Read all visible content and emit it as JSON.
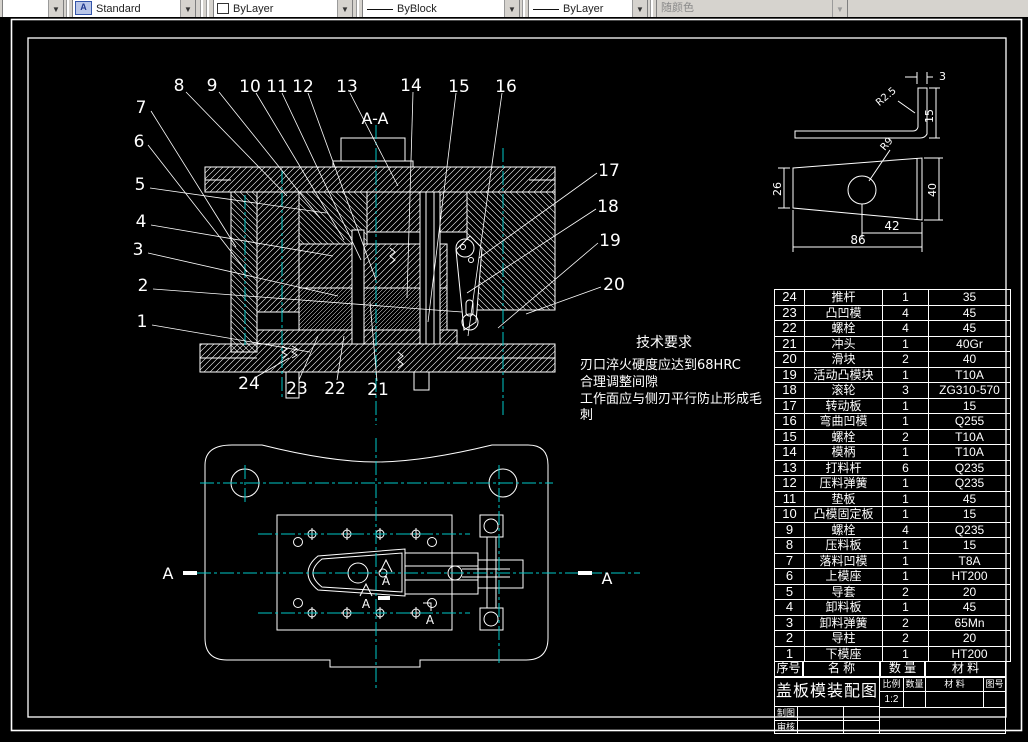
{
  "toolbar": {
    "layer_control": "",
    "text_style": "Standard",
    "color_control": "ByLayer",
    "linetype_control": "ByBlock",
    "lineweight_control": "ByLayer",
    "plot_style_control": "随颜色"
  },
  "tech_requirements": {
    "title": "技术要求",
    "lines": [
      "刃口淬火硬度应达到68HRC",
      "合理调整间隙",
      "工作面应与侧刃平行防止形成毛",
      "刺"
    ]
  },
  "drawing": {
    "section_label": "A-A",
    "section_marker": "A",
    "callouts": [
      "1",
      "2",
      "3",
      "4",
      "5",
      "6",
      "7",
      "8",
      "9",
      "10",
      "11",
      "12",
      "13",
      "14",
      "15",
      "16",
      "17",
      "18",
      "19",
      "20",
      "21",
      "22",
      "23",
      "24"
    ],
    "detail_dims": {
      "thickness": "3",
      "flange_height": "15",
      "bend_radius": "R2.5",
      "hole_radius": "R9",
      "left_width": "26",
      "right_width": "40",
      "hole_offset": "42",
      "length": "86"
    }
  },
  "parts_table": {
    "headers": [
      "序号",
      "名  称",
      "数 量",
      "材  料"
    ],
    "rows": [
      [
        "24",
        "推杆",
        "1",
        "35"
      ],
      [
        "23",
        "凸凹模",
        "4",
        "45"
      ],
      [
        "22",
        "螺栓",
        "4",
        "45"
      ],
      [
        "21",
        "冲头",
        "1",
        "40Gr"
      ],
      [
        "20",
        "滑块",
        "2",
        "40"
      ],
      [
        "19",
        "活动凸模块",
        "1",
        "T10A"
      ],
      [
        "18",
        "滚轮",
        "3",
        "ZG310-570"
      ],
      [
        "17",
        "转动板",
        "1",
        "15"
      ],
      [
        "16",
        "弯曲凹模",
        "1",
        "Q255"
      ],
      [
        "15",
        "螺栓",
        "2",
        "T10A"
      ],
      [
        "14",
        "模柄",
        "1",
        "T10A"
      ],
      [
        "13",
        "打料杆",
        "6",
        "Q235"
      ],
      [
        "12",
        "压料弹簧",
        "1",
        "Q235"
      ],
      [
        "11",
        "垫板",
        "1",
        "45"
      ],
      [
        "10",
        "凸模固定板",
        "1",
        "15"
      ],
      [
        "9",
        "螺栓",
        "4",
        "Q235"
      ],
      [
        "8",
        "压料板",
        "1",
        "15"
      ],
      [
        "7",
        "落料凹模",
        "1",
        "T8A"
      ],
      [
        "6",
        "上模座",
        "1",
        "HT200"
      ],
      [
        "5",
        "导套",
        "2",
        "20"
      ],
      [
        "4",
        "卸料板",
        "1",
        "45"
      ],
      [
        "3",
        "卸料弹簧",
        "2",
        "65Mn"
      ],
      [
        "2",
        "导柱",
        "2",
        "20"
      ],
      [
        "1",
        "下模座",
        "1",
        "HT200"
      ]
    ]
  },
  "title_block": {
    "title": "盖板模装配图",
    "scale_label": "比例",
    "scale_value": "1:2",
    "qty_label": "数量",
    "material_label": "材  料",
    "drawing_no_label": "图号",
    "drafter_label": "制图",
    "checker_label": "审核"
  },
  "colors": {
    "centerline_cyan": "#00c8c8",
    "line_white": "#ffffff",
    "canvas_black": "#000000",
    "toolbar_gray": "#d6d3ce"
  }
}
